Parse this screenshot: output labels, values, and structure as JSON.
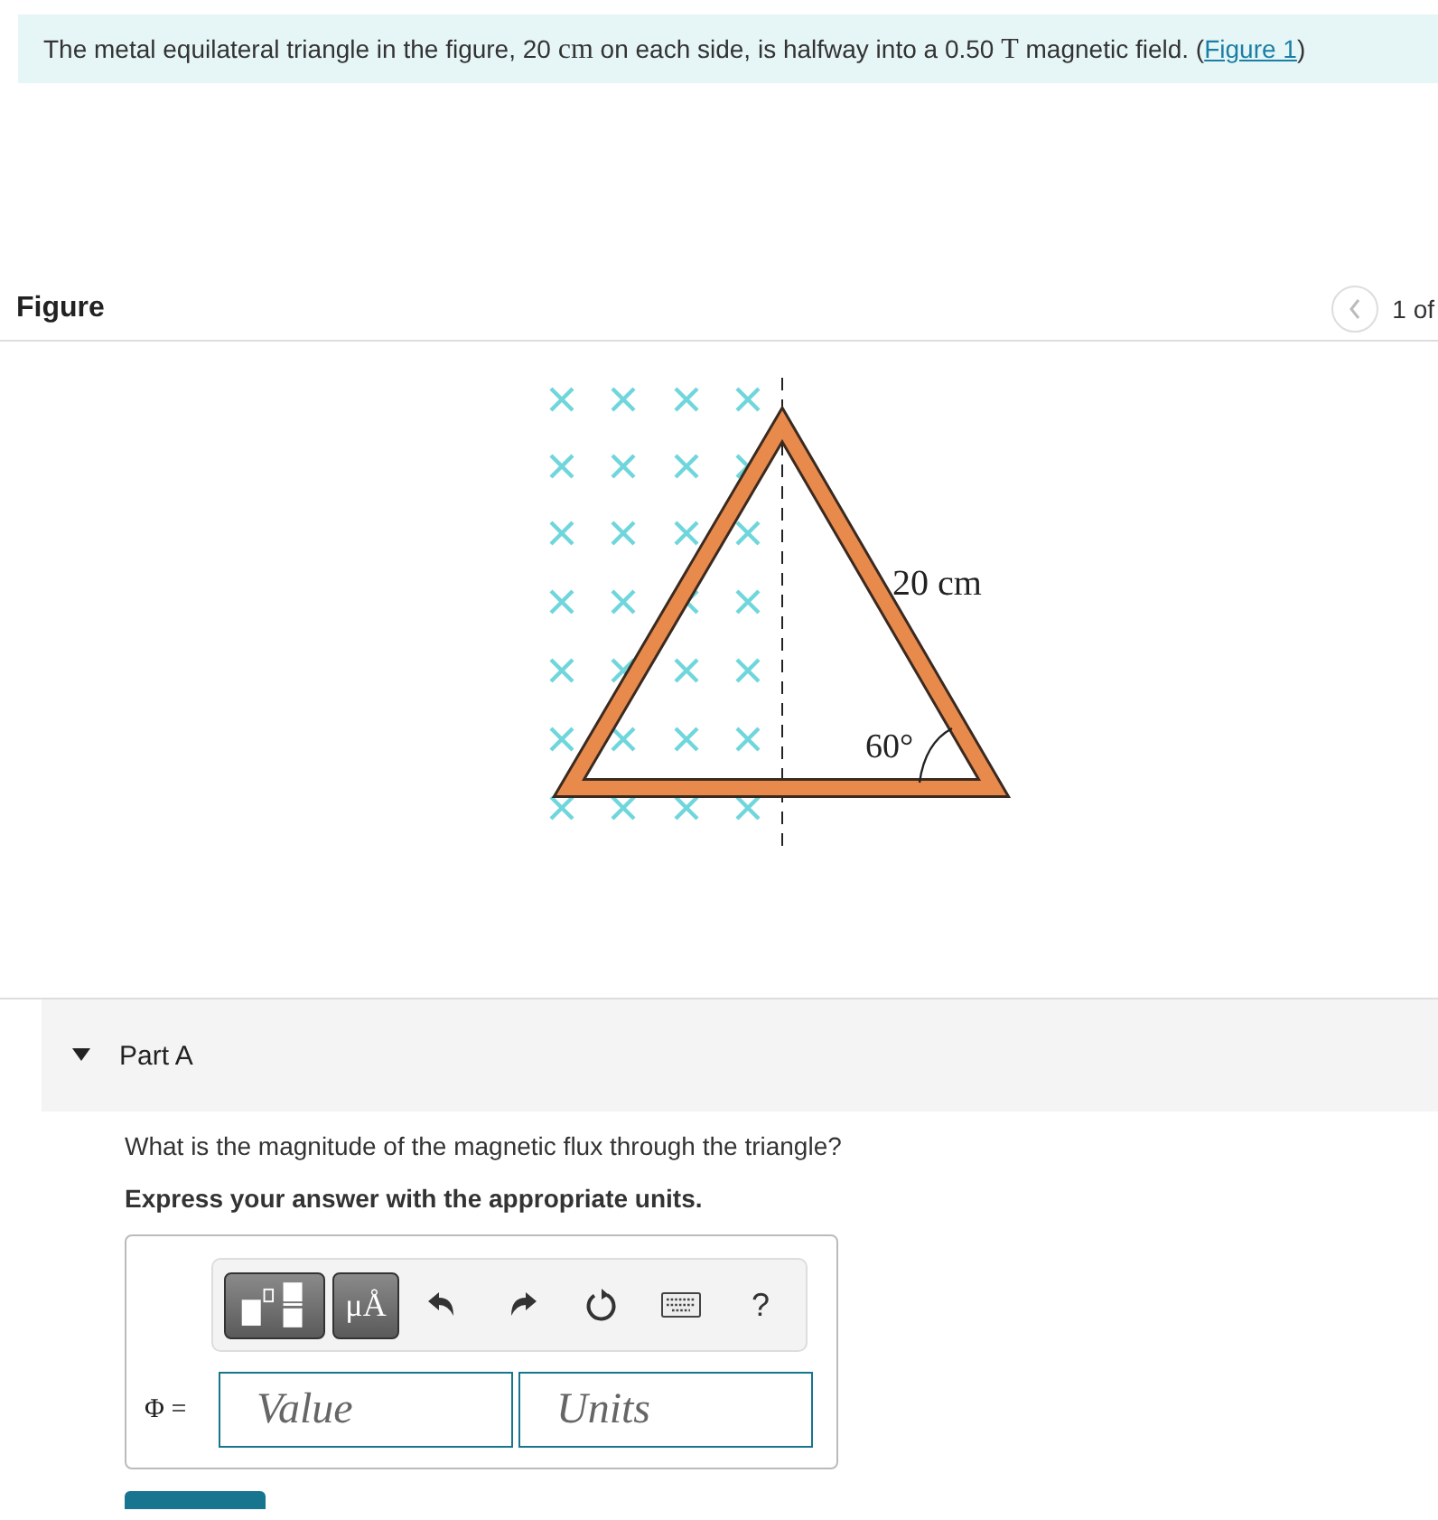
{
  "intro": [
    {
      "kind": "text",
      "text": "The metal equilateral triangle in the figure, 20 "
    },
    {
      "kind": "unit",
      "text": "cm"
    },
    {
      "kind": "text",
      "text": " on each side, is halfway into a 0.50 "
    },
    {
      "kind": "unit",
      "text": "T"
    },
    {
      "kind": "text",
      "text": " magnetic field. ("
    },
    {
      "kind": "link",
      "text": "Figure 1"
    },
    {
      "kind": "text",
      "text": ")"
    }
  ],
  "figure": {
    "heading": "Figure",
    "pager": "1 of",
    "side_label": "20 cm",
    "angle_label": "60°"
  },
  "part": {
    "title": "Part A",
    "expanded": true,
    "question": "What is the magnitude of the magnetic flux through the triangle?",
    "instruction": "Express your answer with the appropriate units.",
    "toolbar": [
      {
        "kind": "templates"
      },
      {
        "kind": "symbols",
        "text": "μÅ"
      },
      {
        "kind": "undo"
      },
      {
        "kind": "redo"
      },
      {
        "kind": "reset"
      },
      {
        "kind": "keyboard"
      },
      {
        "kind": "help",
        "text": "?"
      }
    ],
    "variable": "Φ =",
    "value_placeholder": "Value",
    "units_placeholder": "Units"
  }
}
